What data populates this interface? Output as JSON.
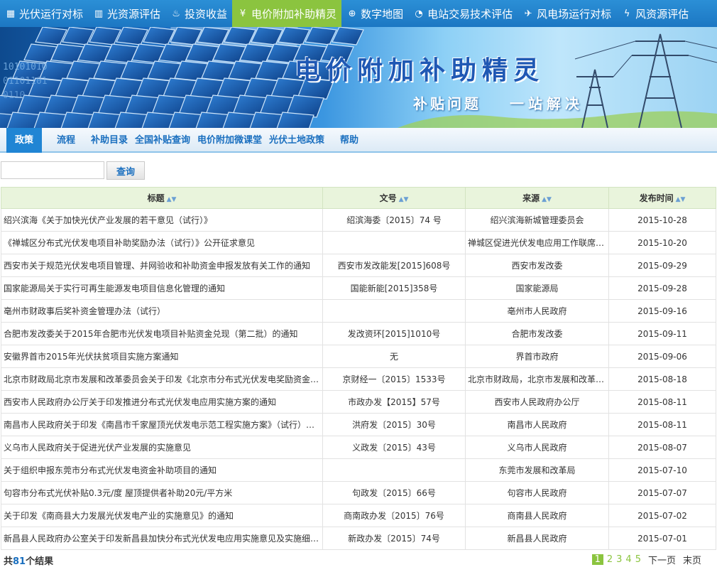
{
  "topnav": [
    {
      "label": "光伏运行对标",
      "icon": "grid-icon"
    },
    {
      "label": "光资源评估",
      "icon": "bar-chart-icon"
    },
    {
      "label": "投资收益",
      "icon": "money-bag-icon"
    },
    {
      "label": "电价附加补助精灵",
      "icon": "yuan-circle-icon",
      "active": true
    },
    {
      "label": "数字地图",
      "icon": "globe-icon"
    },
    {
      "label": "电站交易技术评估",
      "icon": "gauge-icon"
    },
    {
      "label": "风电场运行对标",
      "icon": "plane-icon"
    },
    {
      "label": "风资源评估",
      "icon": "lightning-icon"
    }
  ],
  "banner": {
    "title": "电价附加补助精灵",
    "slogan_left": "补贴问题",
    "slogan_right": "一站解决"
  },
  "subnav": [
    "政策",
    "流程",
    "补助目录",
    "全国补贴查询",
    "电价附加微课堂",
    "光伏土地政策",
    "帮助"
  ],
  "search": {
    "placeholder": "",
    "button": "查询"
  },
  "table": {
    "headers": [
      "标题",
      "文号",
      "来源",
      "发布时间"
    ],
    "rows": [
      [
        "绍兴滨海《关于加快光伏产业发展的若干意见（试行）》",
        "绍滨海委〔2015〕74 号",
        "绍兴滨海新城管理委员会",
        "2015-10-28"
      ],
      [
        "《禅城区分布式光伏发电项目补助奖励办法（试行）》公开征求意见",
        "",
        "禅城区促进光伏发电应用工作联席会议办公室",
        "2015-10-20"
      ],
      [
        "西安市关于规范光伏发电项目管理、并网验收和补助资金申报发放有关工作的通知",
        "西安市发改能发[2015]608号",
        "西安市发改委",
        "2015-09-29"
      ],
      [
        "国家能源局关于实行可再生能源发电项目信息化管理的通知",
        "国能新能[2015]358号",
        "国家能源局",
        "2015-09-28"
      ],
      [
        "亳州市财政事后奖补资金管理办法（试行）",
        "",
        "亳州市人民政府",
        "2015-09-16"
      ],
      [
        "合肥市发改委关于2015年合肥市光伏发电项目补贴资金兑现（第二批）的通知",
        "发改资环[2015]1010号",
        "合肥市发改委",
        "2015-09-11"
      ],
      [
        "安徽界首市2015年光伏扶贫项目实施方案通知",
        "无",
        "界首市政府",
        "2015-09-06"
      ],
      [
        "北京市财政局北京市发展和改革委员会关于印发《北京市分布式光伏发电奖励资金管理办法》的通知",
        "京财经一〔2015〕1533号",
        "北京市财政局，北京市发展和改革委员会",
        "2015-08-18"
      ],
      [
        "西安市人民政府办公厅关于印发推进分布式光伏发电应用实施方案的通知",
        "市政办发【2015】57号",
        "西安市人民政府办公厅",
        "2015-08-11"
      ],
      [
        "南昌市人民政府关于印发《南昌市千家屋顶光伏发电示范工程实施方案》（试行）的通知",
        "洪府发〔2015〕30号",
        "南昌市人民政府",
        "2015-08-11"
      ],
      [
        "义乌市人民政府关于促进光伏产业发展的实施意见",
        "义政发〔2015〕43号",
        "义乌市人民政府",
        "2015-08-07"
      ],
      [
        "关于组织申报东莞市分布式光伏发电资金补助项目的通知",
        "",
        "东莞市发展和改革局",
        "2015-07-10"
      ],
      [
        "句容市分布式光伏补贴0.3元/度 屋顶提供者补助20元/平方米",
        "句政发〔2015〕66号",
        "句容市人民政府",
        "2015-07-07"
      ],
      [
        "关于印发《南商县大力发展光伏发电产业的实施意见》的通知",
        "商南政办发〔2015〕76号",
        "商南县人民政府",
        "2015-07-02"
      ],
      [
        "新昌县人民政府办公室关于印发新昌县加快分布式光伏发电应用实施意见及实施细则的通知",
        "新政办发〔2015〕74号",
        "新昌县人民政府",
        "2015-07-01"
      ]
    ]
  },
  "footer": {
    "total_prefix": "共",
    "total_count": "81",
    "total_suffix": "个结果",
    "pages": [
      "1",
      "2",
      "3",
      "4",
      "5"
    ],
    "current_page": "1",
    "next_label": "下一页",
    "last_label": "末页"
  }
}
